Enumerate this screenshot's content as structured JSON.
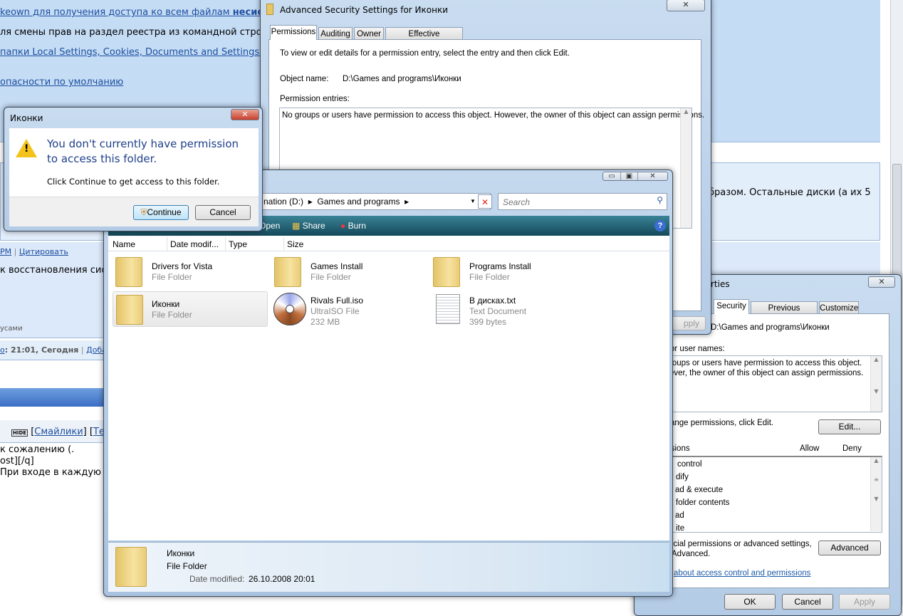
{
  "webpage": {
    "line1_link": "keown для получения доступа ко всем файлам ",
    "line1_bold": "несистем",
    "line2": "ля смены прав на раздел реестра из командной строки:",
    "line3_link": "папки Local Settings, Cookies, Documents and Settings?",
    "line4_link": "опасности по умолчанию",
    "right_text": "бразом. Остальные диски (а их 5",
    "pm_link": "PM",
    "quote_link": "Цитировать",
    "post_text": "к восстановления сист",
    "signature": "усами",
    "time_label": "о",
    "time_value": ": 21:01, Сегодня",
    "add_link": "Добав",
    "hide_icon_label": "HIDE",
    "smileys_link": "Смайлики",
    "tags_link": "Тег",
    "editor_lines": [
      "к сожалению (.",
      "ost][/q]",
      "При входе в каждую п"
    ]
  },
  "properties_dialog": {
    "title": "rties",
    "close_label": "✕",
    "tabs": [
      {
        "label": "Security",
        "selected": true
      },
      {
        "label": "Previous Versions"
      },
      {
        "label": "Customize"
      }
    ],
    "object_path": "D:\\Games and programs\\Иконки",
    "group_label": "or user names:",
    "group_text": [
      "roups or users have permission to access this object.",
      "ever, the owner of this object can assign permissions."
    ],
    "change_text": "ange permissions, click Edit.",
    "edit_button": "Edit...",
    "perm_header": "ssions",
    "allow_header": "Allow",
    "deny_header": "Deny",
    "permissions": [
      "control",
      "dify",
      "ad & execute",
      "folder contents",
      "ad",
      "ite"
    ],
    "special_text": [
      "ecial permissions or advanced settings,",
      "Advanced."
    ],
    "advanced_button": "Advanced",
    "learn_link": "about access control and permissions",
    "ok_button": "OK",
    "cancel_button": "Cancel",
    "apply_button": "Apply"
  },
  "advanced_dialog": {
    "title": "Advanced Security Settings for Иконки",
    "close_label": "✕",
    "tabs": [
      {
        "label": "Permissions",
        "selected": true
      },
      {
        "label": "Auditing"
      },
      {
        "label": "Owner"
      },
      {
        "label": "Effective Permissions"
      }
    ],
    "instruction": "To view or edit details for a permission entry, select the entry and then click Edit.",
    "object_name_label": "Object name:",
    "object_name_value": "D:\\Games and programs\\Иконки",
    "entries_label": "Permission entries:",
    "entries_text": "No groups or users have permission to access this object. However, the owner of this object can assign permissions.",
    "apply_button": "pply"
  },
  "explorer": {
    "breadcrumb": [
      "nation (D:)",
      "Games and programs"
    ],
    "search_placeholder": "Search",
    "toolbar": {
      "open": "Open",
      "share": "Share",
      "burn": "Burn"
    },
    "columns": [
      "Name",
      "Date modif...",
      "Type",
      "Size"
    ],
    "items": [
      {
        "name": "Drivers for Vista",
        "type": "File Folder",
        "icon": "folder-icon"
      },
      {
        "name": "Games Install",
        "type": "File Folder",
        "icon": "folder-icon"
      },
      {
        "name": "Programs Install",
        "type": "File Folder",
        "icon": "folder-icon"
      },
      {
        "name": "Иконки",
        "type": "File Folder",
        "icon": "folder-icon",
        "selected": true
      },
      {
        "name": "Rivals Full.iso",
        "type": "UltraISO File",
        "size": "232 MB",
        "icon": "disc-icon"
      },
      {
        "name": "В дисках.txt",
        "type": "Text Document",
        "size": "399 bytes",
        "icon": "text-document-icon"
      }
    ],
    "details": {
      "name": "Иконки",
      "type": "File Folder",
      "date_label": "Date modified:",
      "date_value": "26.10.2008 20:01"
    }
  },
  "permission_dialog": {
    "title": "Иконки",
    "heading": "You don't currently have permission to access this folder.",
    "body": "Click Continue to get access to this folder.",
    "continue_button": "Continue",
    "cancel_button": "Cancel",
    "close_label": "✕"
  },
  "colors": {
    "accent": "#1d4fa0",
    "page_blue": "#c5dcf5",
    "explorer_toolbar": "#1f5d6e",
    "heading_blue": "#1e3f8a"
  }
}
